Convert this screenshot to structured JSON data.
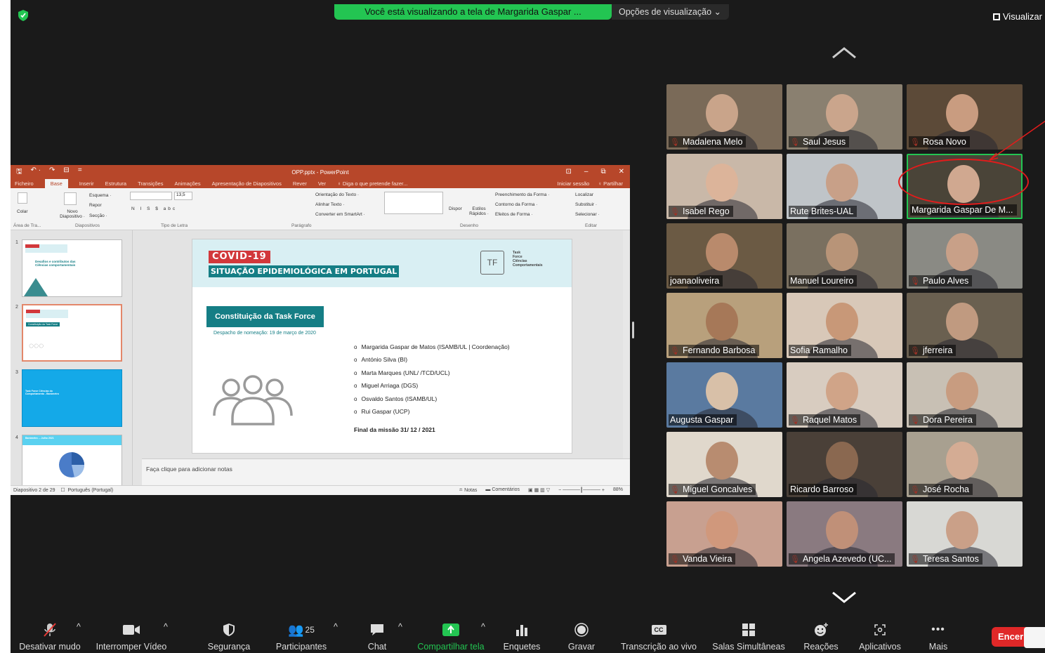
{
  "banner": {
    "share_text": "Você está visualizando a tela de Margarida Gaspar ...",
    "view_options": "Opções de visualização ⌄",
    "visualizar": "Visualizar"
  },
  "ppt": {
    "quick_access": [
      "🖫",
      "↶ ·",
      "↷",
      "⊟",
      "="
    ],
    "window_title": "OPP.pptx - PowerPoint",
    "window_controls": [
      "⊡",
      "–",
      "⧉",
      "✕"
    ],
    "tabs": [
      "Ficheiro",
      "Base",
      "Inserir",
      "Estrutura",
      "Transições",
      "Animações",
      "Apresentação de Diapositivos",
      "Rever",
      "Ver",
      "♀ Diga o que pretende fazer..."
    ],
    "active_tab": "Base",
    "signin": "Iniciar sessão",
    "share": "♀ Partilhar",
    "ribbon": {
      "colar": "Colar",
      "novo": "Novo Diapositivo ·",
      "esquema": "Esquema ·",
      "repor": "Repor",
      "seccao": "Secção ·",
      "font_size": "13,5",
      "orientacao": "Orientação do Texto ·",
      "alinhar": "Alinhar Texto ·",
      "converter": "Converter em SmartArt ·",
      "dispor": "Dispor",
      "estilos": "Estilos Rápidos ·",
      "preenchimento": "Preenchimento da Forma ·",
      "contorno": "Contorno da Forma ·",
      "efeitos": "Efeitos de Forma ·",
      "localizar": "Localizar",
      "substituir": "Substituir ·",
      "selecionar": "Selecionar ·",
      "groups": [
        "Área de Tra...",
        "Diapositivos",
        "Tipo de Letra",
        "Parágrafo",
        "Desenho",
        "Editar"
      ]
    },
    "thumbnails": [
      {
        "num": "1",
        "text": "Desafios e contributos das Ciências comportamentais"
      },
      {
        "num": "2",
        "text": "Constituição da Task Force"
      },
      {
        "num": "3",
        "text": "Task Force Ciências do Comportamento - Barómetro"
      },
      {
        "num": "4",
        "text": "Barómetro ... Julho 2021"
      }
    ],
    "slide": {
      "covid": "COVID-19",
      "situacao": "SITUAÇÃO EPIDEMIOLÓGICA EM PORTUGAL",
      "logo": "TF",
      "logo_text": [
        "Task",
        "Force",
        "Ciências",
        "Comportamentais"
      ],
      "heading": "Constituição da Task Force",
      "despacho": "Despacho de nomeação: 19 de março de 2020",
      "members": [
        "Margarida Gaspar de Matos (ISAMB/UL | Coordenação)",
        "António Silva (BI)",
        "Marta Marques (UNL/ /TCD/UCL)",
        "Miguel Arriaga (DGS)",
        "Osvaldo Santos (ISAMB/UL)",
        "Rui Gaspar (UCP)"
      ],
      "final": "Final da missão 31/ 12 / 2021"
    },
    "notes_placeholder": "Faça clique para adicionar notas",
    "status_left": "Diapositivo 2 de 29",
    "status_lang": "Português (Portugal)",
    "status_notes": "≐ Notas",
    "status_comments": "▬ Comentários",
    "zoom": "88%"
  },
  "participants": [
    {
      "name": "Madalena Melo",
      "muted": true,
      "bg": "#7a6a58",
      "skin": "#c9a48a"
    },
    {
      "name": "Saul Jesus",
      "muted": true,
      "bg": "#8a8070",
      "skin": "#caa58c"
    },
    {
      "name": "Rosa Novo",
      "muted": true,
      "bg": "#5c4a38",
      "skin": "#c99c80"
    },
    {
      "name": "Isabel Rego",
      "muted": true,
      "bg": "#c9b8a8",
      "skin": "#dcb49a"
    },
    {
      "name": "Rute Brites-UAL",
      "muted": false,
      "bg": "#bfc4c8",
      "skin": "#c8a088"
    },
    {
      "name": "Margarida Gaspar De M...",
      "muted": false,
      "bg": "#4a4438",
      "skin": "#d0a890",
      "active": true
    },
    {
      "name": "joanaoliveira",
      "muted": false,
      "bg": "#6b5a44",
      "skin": "#b98a6c"
    },
    {
      "name": "Manuel Loureiro",
      "muted": false,
      "bg": "#7a7060",
      "skin": "#b89478"
    },
    {
      "name": "Paulo Alves",
      "muted": true,
      "bg": "#8a8a84",
      "skin": "#c8a088"
    },
    {
      "name": "Fernando Barbosa",
      "muted": true,
      "bg": "#b8a07c",
      "skin": "#a67858"
    },
    {
      "name": "Sofia Ramalho",
      "muted": false,
      "bg": "#d8c8b8",
      "skin": "#c89878"
    },
    {
      "name": "jferreira",
      "muted": true,
      "bg": "#6a6050",
      "skin": "#c09a80"
    },
    {
      "name": "Augusta  Gaspar",
      "muted": false,
      "bg": "#5a7aa0",
      "skin": "#d8c0a8"
    },
    {
      "name": "Raquel Matos",
      "muted": true,
      "bg": "#d8ccc0",
      "skin": "#d0a488"
    },
    {
      "name": "Dora Pereira",
      "muted": true,
      "bg": "#c8c0b4",
      "skin": "#c89c80"
    },
    {
      "name": "Miguel Goncalves",
      "muted": true,
      "bg": "#e0d8cc",
      "skin": "#b88c70"
    },
    {
      "name": "Ricardo Barroso",
      "muted": false,
      "bg": "#4a4038",
      "skin": "#8a6850"
    },
    {
      "name": "José Rocha",
      "muted": true,
      "bg": "#a8a090",
      "skin": "#d4ac94"
    },
    {
      "name": "Vanda Vieira",
      "muted": true,
      "bg": "#c8a090",
      "skin": "#d0987c"
    },
    {
      "name": "Angela Azevedo (UC...",
      "muted": true,
      "bg": "#8a7a80",
      "skin": "#c09078"
    },
    {
      "name": "Teresa Santos",
      "muted": true,
      "bg": "#d8d8d4",
      "skin": "#caa088"
    }
  ],
  "toolbar": {
    "mute": "Desativar mudo",
    "video": "Interromper Vídeo",
    "security": "Segurança",
    "participants": "Participantes",
    "participants_count": "25",
    "chat": "Chat",
    "share": "Compartilhar tela",
    "polls": "Enquetes",
    "record": "Gravar",
    "transcription": "Transcrição ao vivo",
    "rooms": "Salas Simultâneas",
    "reactions": "Reações",
    "apps": "Aplicativos",
    "more": "Mais",
    "end": "Encer"
  },
  "colors": {
    "share_green": "#23c552",
    "ppt_red": "#b7472a",
    "teal": "#157e85",
    "end_red": "#e02828"
  }
}
